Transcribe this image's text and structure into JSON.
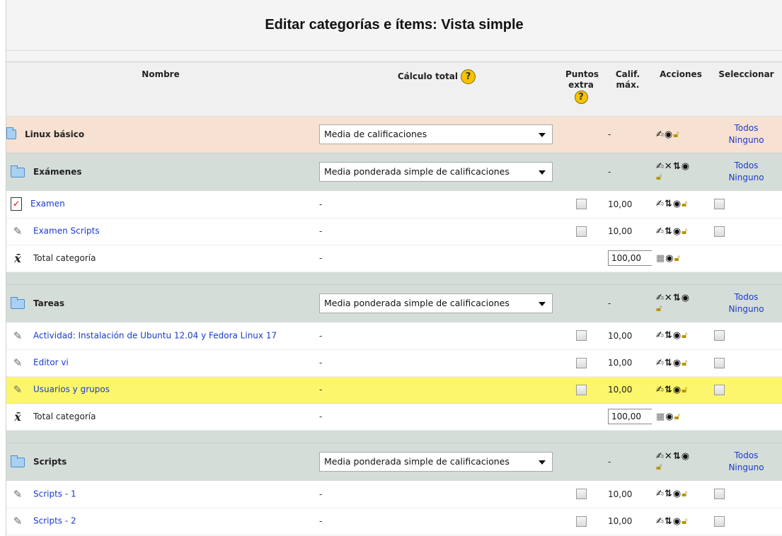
{
  "page": {
    "title": "Editar categorías e ítems: Vista simple"
  },
  "columns": {
    "name": "Nombre",
    "total_calc": "Cálculo total",
    "extra_points": "Puntos extra",
    "max_grade": "Calif. máx.",
    "actions": "Acciones",
    "select": "Seleccionar"
  },
  "icons": {
    "help": "help-icon",
    "folder": "folder-icon",
    "quiz": "quiz-icon",
    "assignment": "assignment-icon",
    "total": "sigma-icon",
    "edit": "edit-icon",
    "delete": "delete-icon",
    "move": "move-icon",
    "hide": "eye-icon",
    "lock": "lock-icon"
  },
  "glyphs": {
    "help": "?",
    "dash": "-",
    "quiz": "✓",
    "assignment": "✎",
    "sigma": "x̄"
  },
  "colors": {
    "highlight": "#fbf66c",
    "category_row": "#d5ddd9",
    "root_row": "#f6e1d3",
    "link": "#1a3acd"
  },
  "links": {
    "all": "Todos",
    "none": "Ninguno"
  },
  "root": {
    "name": "Linux básico",
    "aggregation": "Media de calificaciones",
    "max": "-"
  },
  "categories": [
    {
      "name": "Exámenes",
      "aggregation": "Media ponderada simple de calificaciones",
      "max": "-",
      "items": [
        {
          "name": "Examen",
          "type": "quiz",
          "calc": "-",
          "max": "10,00"
        },
        {
          "name": "Examen Scripts",
          "type": "assignment",
          "calc": "-",
          "max": "10,00"
        }
      ],
      "total": {
        "name": "Total categoría",
        "calc": "-",
        "max": "100,00"
      }
    },
    {
      "name": "Tareas",
      "aggregation": "Media ponderada simple de calificaciones",
      "max": "-",
      "items": [
        {
          "name": "Actividad: Instalación de Ubuntu 12.04 y Fedora Linux 17",
          "type": "assignment",
          "calc": "-",
          "max": "10,00"
        },
        {
          "name": "Editor vi",
          "type": "assignment",
          "calc": "-",
          "max": "10,00"
        },
        {
          "name": "Usuarios y grupos",
          "type": "assignment",
          "calc": "-",
          "max": "10,00",
          "highlighted": true
        }
      ],
      "total": {
        "name": "Total categoría",
        "calc": "-",
        "max": "100,00"
      }
    },
    {
      "name": "Scripts",
      "aggregation": "Media ponderada simple de calificaciones",
      "max": "-",
      "items": [
        {
          "name": "Scripts - 1",
          "type": "assignment",
          "calc": "-",
          "max": "10,00"
        },
        {
          "name": "Scripts - 2",
          "type": "assignment",
          "calc": "-",
          "max": "10,00"
        }
      ]
    }
  ]
}
